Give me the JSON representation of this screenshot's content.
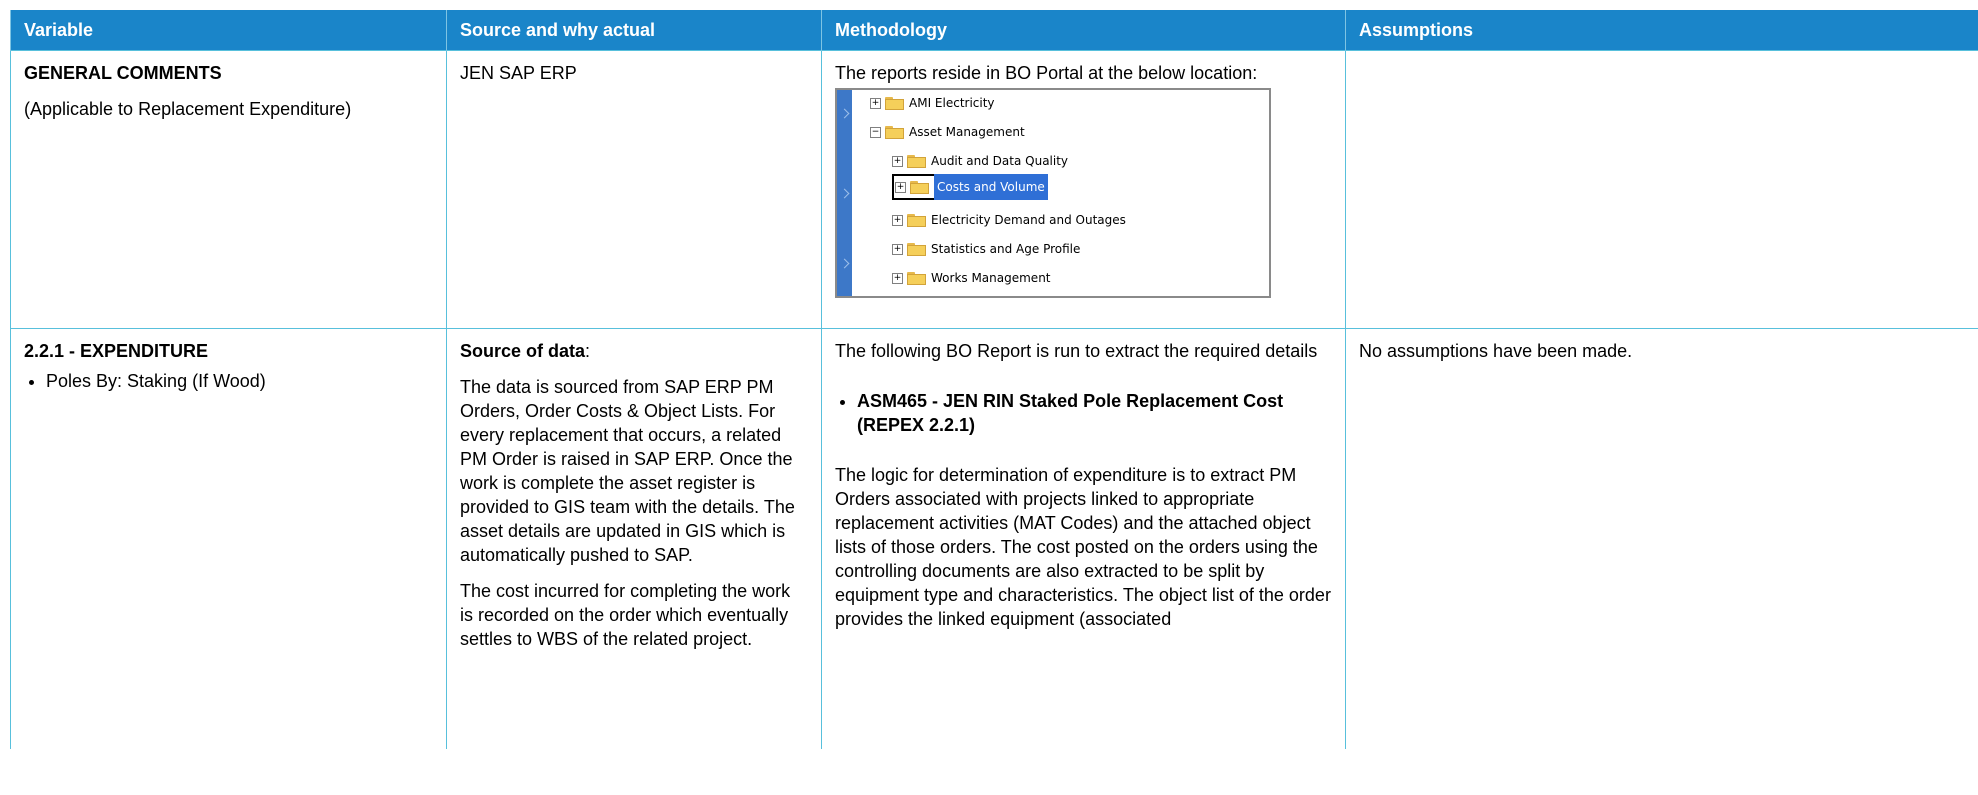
{
  "headers": [
    "Variable",
    "Source and why actual",
    "Methodology",
    "Assumptions"
  ],
  "row1": {
    "variable_title": "GENERAL COMMENTS",
    "variable_sub": "(Applicable to Replacement Expenditure)",
    "source": "JEN SAP ERP",
    "methodology_intro": "The reports reside in BO Portal at the below location:",
    "assumptions": ""
  },
  "tree": {
    "items": [
      "AMI Electricity",
      "Asset Management",
      "Audit and Data Quality",
      "Costs and Volume",
      "Electricity Demand and Outages",
      "Statistics and Age Profile",
      "Works Management"
    ],
    "expanded_symbol": "−",
    "collapsed_symbol": "+",
    "selected_index": 3
  },
  "row2": {
    "variable_title": "2.2.1 - EXPENDITURE",
    "variable_bullet": "Poles By: Staking (If Wood)",
    "source_label": "Source of data",
    "source_colon": ":",
    "source_p1": "The data is sourced from SAP ERP PM Orders, Order Costs & Object Lists. For every replacement that occurs, a related PM Order is raised in SAP ERP. Once the work is complete the asset register is provided to GIS team with the details. The asset details are updated in GIS which is automatically pushed to SAP.",
    "source_p2": "The cost incurred for completing the work is recorded on the order which eventually settles to WBS of the related project.",
    "methodology_intro": "The following BO Report is run to extract the required details",
    "report_name": "ASM465 - JEN RIN Staked Pole Replacement Cost (REPEX 2.2.1)",
    "methodology_logic": "The logic for determination of expenditure is to extract PM Orders associated with projects linked to appropriate replacement activities (MAT Codes) and the attached object lists of those orders. The cost posted on the orders using the controlling documents are also extracted to be split by equipment type and characteristics. The object list of the order provides the linked equipment (associated",
    "assumptions": "No assumptions have been made."
  },
  "colors": {
    "header_bg": "#1a85c9",
    "border": "#58c0dc",
    "tree_rail": "#3d78c8",
    "selection": "#2f6fd6"
  }
}
